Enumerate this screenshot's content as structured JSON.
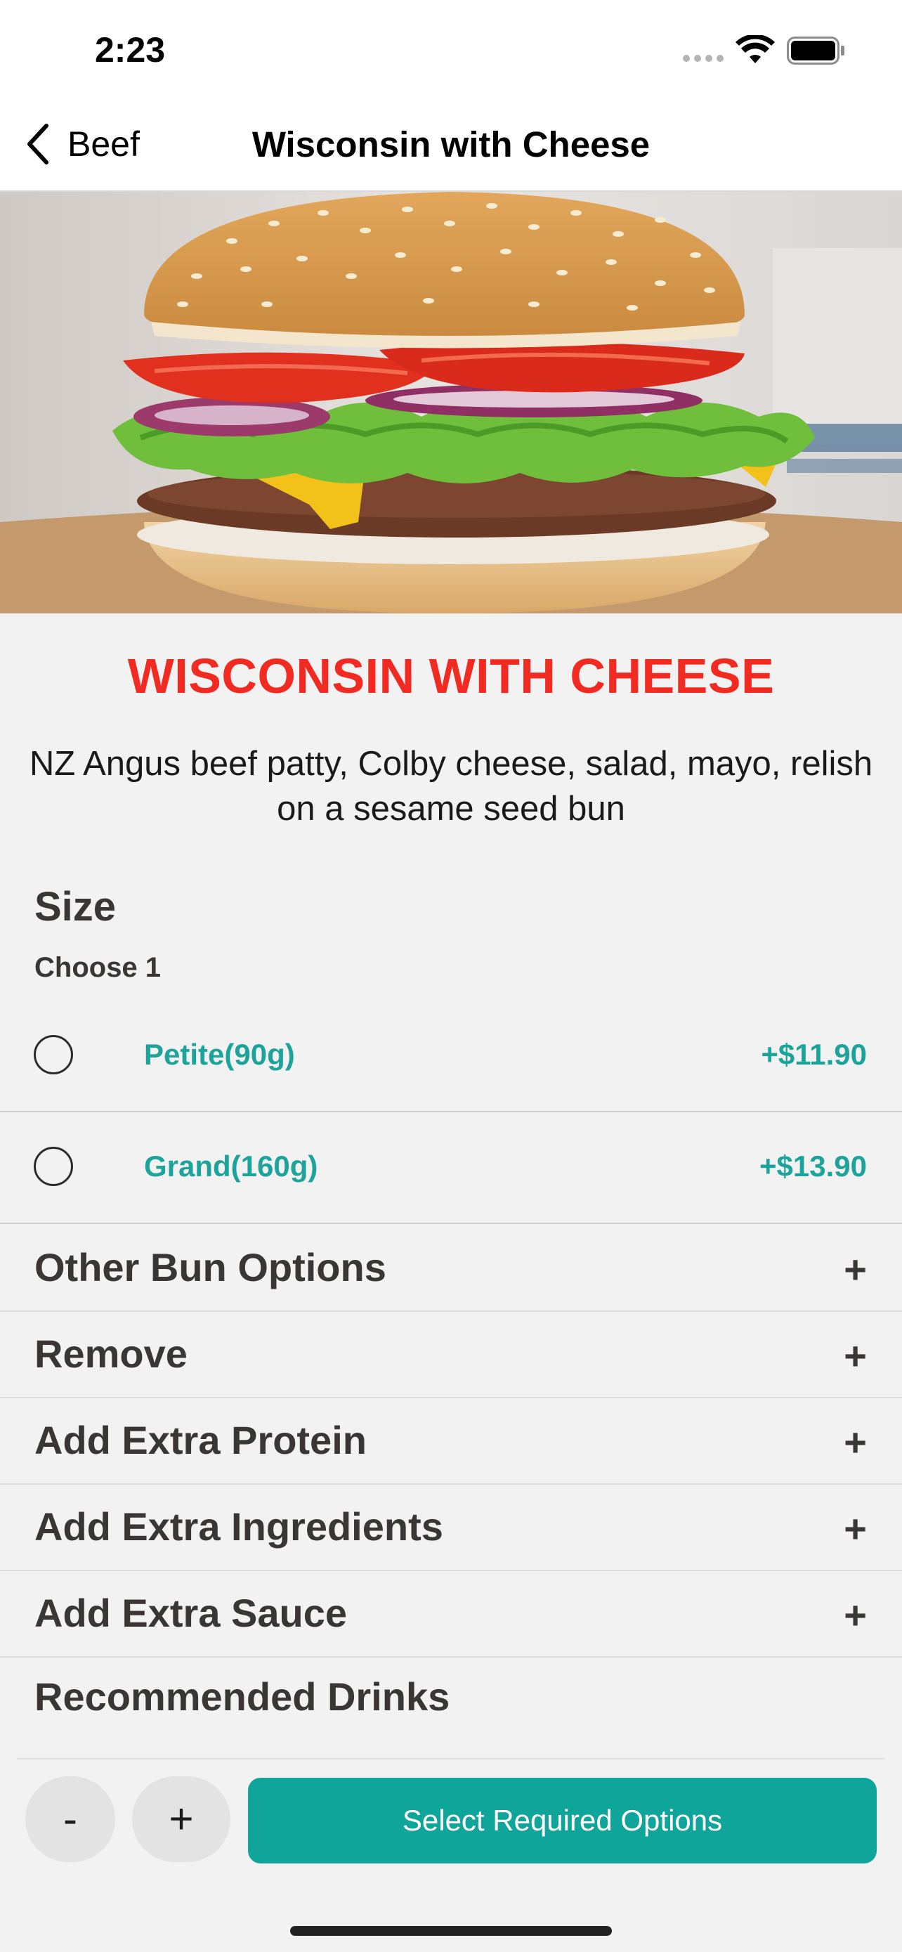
{
  "status_bar": {
    "time": "2:23"
  },
  "nav": {
    "back_label": "Beef",
    "title": "Wisconsin with Cheese"
  },
  "product": {
    "title": "WISCONSIN WITH CHEESE",
    "description": "NZ Angus beef patty, Colby cheese, salad, mayo, relish on a sesame seed bun"
  },
  "size": {
    "title": "Size",
    "subtitle": "Choose 1",
    "options": [
      {
        "label": "Petite(90g)",
        "price": "+$11.90"
      },
      {
        "label": "Grand(160g)",
        "price": "+$13.90"
      }
    ]
  },
  "accordions": [
    {
      "label": "Other Bun Options",
      "icon": "+"
    },
    {
      "label": "Remove",
      "icon": "+"
    },
    {
      "label": "Add Extra Protein",
      "icon": "+"
    },
    {
      "label": "Add Extra Ingredients",
      "icon": "+"
    },
    {
      "label": "Add Extra Sauce",
      "icon": "+"
    }
  ],
  "recommended": {
    "title": "Recommended Drinks"
  },
  "footer": {
    "minus_label": "-",
    "plus_label": "+",
    "cta_label": "Select Required Options"
  },
  "colors": {
    "accent": "#10a59a",
    "title_red": "#f12a22",
    "option_teal": "#1ca49b"
  }
}
